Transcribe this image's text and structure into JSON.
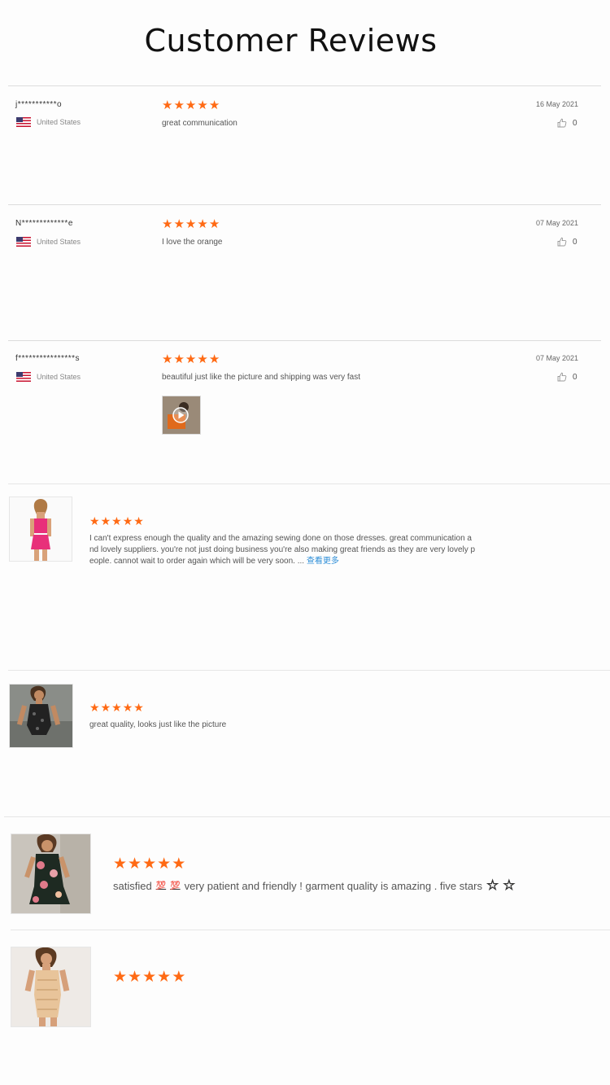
{
  "page": {
    "title": "Customer Reviews"
  },
  "colors": {
    "star": "#ff6a14",
    "link": "#2f8fd8",
    "divider": "#dcdcdc"
  },
  "top_reviews": [
    {
      "user": "j***********o",
      "country": "United States",
      "rating": 5,
      "text": "great communication",
      "date": "16 May 2021",
      "likes": "0"
    },
    {
      "user": "N*************e",
      "country": "United States",
      "rating": 5,
      "text": "I love the orange",
      "date": "07 May 2021",
      "likes": "0"
    },
    {
      "user": "f****************s",
      "country": "United States",
      "rating": 5,
      "text": "beautiful just like the picture and shipping was very fast",
      "date": "07 May 2021",
      "likes": "0",
      "has_video": true
    }
  ],
  "photo_reviews": [
    {
      "rating": 5,
      "lines": [
        "I can't express enough the quality and the amazing sewing done on those dresses. great communication a",
        "nd lovely suppliers. you're not just doing business you're also making great friends as they are very lovely p",
        "eople. cannot wait to order again which will be very soon. ..."
      ],
      "more": "查看更多"
    },
    {
      "rating": 5,
      "text": "great quality, looks just like the picture"
    },
    {
      "rating": 5,
      "text_before": "satisfied",
      "emoji_1": "💯",
      "emoji_2": "💯",
      "text_after": "very patient and friendly ! garment quality is amazing . five stars",
      "star_glyph": "☆"
    },
    {
      "rating": 5,
      "text": ""
    }
  ]
}
